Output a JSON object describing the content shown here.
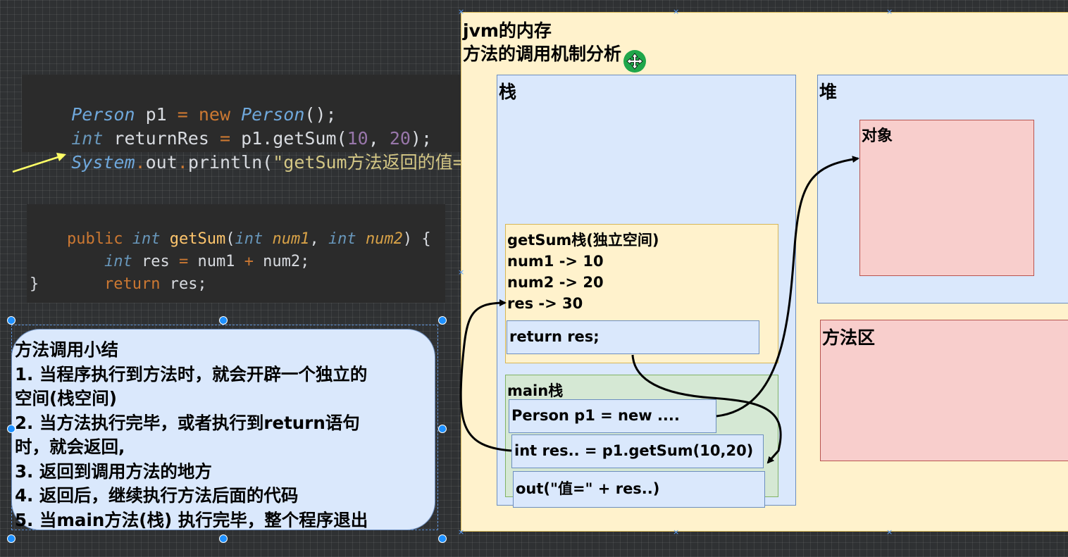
{
  "code_call": {
    "lines": [
      [
        "Person",
        " p1 ",
        "=",
        " ",
        "new",
        " ",
        "Person",
        "();"
      ],
      [
        "int",
        " returnRes ",
        "=",
        " p1.getSum(",
        "10",
        ", ",
        "20",
        ");"
      ],
      [
        "System",
        ".",
        "out",
        ".",
        "println(",
        "\"getSum方法返回的值=\""
      ]
    ]
  },
  "code_method": {
    "line1": {
      "kw_public": "public",
      "kw_int": "int",
      "name": "getSum",
      "paren": "(",
      "t1": "int",
      "p1": "num1",
      "comma": ",",
      "t2": "int",
      "p2": "num2",
      "close": ") {"
    },
    "line2": {
      "kw_int": "int",
      "rest_a": " res ",
      "op_eq": "=",
      "rest_b": " num1 ",
      "op_plus": "+",
      "rest_c": " num2;"
    },
    "line3": {
      "kw_return": "return",
      "rest": " res;"
    },
    "line4": "}"
  },
  "summary": {
    "lines": [
      "方法调用小结",
      "1. 当程序执行到方法时，就会开辟一个独立的",
      "空间(栈空间)",
      "2. 当方法执行完毕，或者执行到return语句",
      "时，就会返回,",
      "3. 返回到调用方法的地方",
      "4. 返回后，继续执行方法后面的代码",
      "5. 当main方法(栈) 执行完毕，整个程序退出"
    ]
  },
  "memory": {
    "title_line1": "jvm的内存",
    "title_line2": "方法的调用机制分析",
    "stack_label": "栈",
    "heap_label": "堆",
    "object_label": "对象",
    "method_area_label": "方法区",
    "getsum_frame": {
      "lines": [
        "getSum栈(独立空间)",
        "num1 -> 10",
        "num2 -> 20",
        "res -> 30"
      ],
      "return_box": "return res;"
    },
    "main_frame": {
      "label": "main栈",
      "box1": "Person p1 = new ....",
      "box2": "int res.. = p1.getSum(10,20)",
      "box3": "out(\"值=\" + res..)"
    }
  },
  "colors": {
    "memory_bg": "#fff2cc",
    "stack_bg": "#dae8fc",
    "object_bg": "#f8cecc",
    "main_frame_bg": "#d5e8d4",
    "getsum_frame_bg": "#fff2cc",
    "arrow": "#000000",
    "pointer_arrow": "#ffff66",
    "handle": "#1e90ff"
  },
  "icons": [
    "move-cursor-icon",
    "arrow-pointer-icon"
  ]
}
